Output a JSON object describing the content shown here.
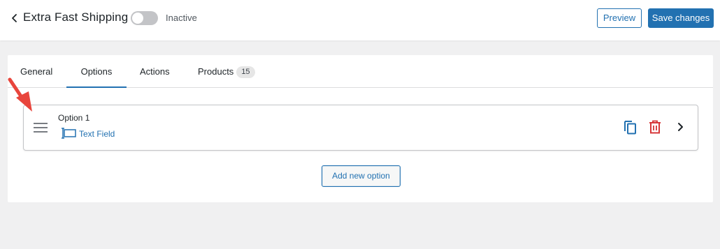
{
  "header": {
    "title": "Extra Fast Shipping",
    "status": "Inactive",
    "toggle_on": false,
    "preview_label": "Preview",
    "save_label": "Save changes"
  },
  "tabs": [
    {
      "label": "General",
      "active": false
    },
    {
      "label": "Options",
      "active": true
    },
    {
      "label": "Actions",
      "active": false
    },
    {
      "label": "Products",
      "active": false,
      "badge": "15"
    }
  ],
  "options": [
    {
      "title": "Option 1",
      "type": "Text Field",
      "type_icon": "text-field-icon"
    }
  ],
  "add_option_label": "Add new option",
  "icons": {
    "back": "chevron-left-icon",
    "drag": "drag-handle-icon",
    "duplicate": "copy-icon",
    "delete": "trash-icon",
    "expand": "chevron-right-icon"
  },
  "colors": {
    "accent": "#2271b1",
    "danger": "#d63638",
    "annotation": "#e8453c",
    "background": "#f0f0f1"
  }
}
